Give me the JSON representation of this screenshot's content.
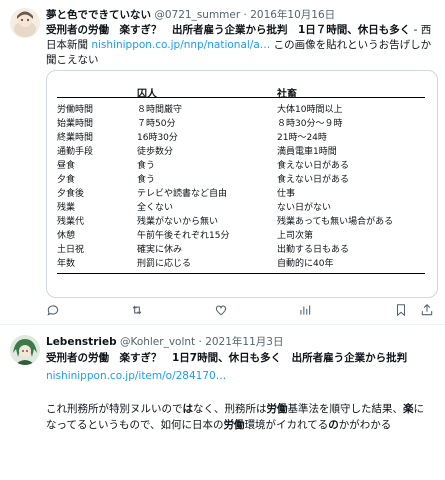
{
  "tweet1": {
    "name": "夢と色でできていない",
    "handle": "@0721_summer",
    "date": "· 2016年10月16日",
    "headline": "受刑者の労働　楽すぎ？　出所者雇う企業から批判　1日７時間、休日も多く",
    "source": " - 西日本新聞 ",
    "link": "nishinippon.co.jp/nnp/national/a…",
    "comment": " この画像を貼れというお告げしか聞こえない",
    "table": {
      "header": [
        "",
        "囚人",
        "社畜"
      ],
      "rows": [
        [
          "労働時間",
          "８時間厳守",
          "大体10時間以上"
        ],
        [
          "始業時間",
          "７時50分",
          "８時30分〜９時"
        ],
        [
          "終業時間",
          "16時30分",
          "21時〜24時"
        ],
        [
          "通勤手段",
          "徒歩数分",
          "満員電車1時間"
        ],
        [
          "昼食",
          "食う",
          "食えない日がある"
        ],
        [
          "夕食",
          "食う",
          "食えない日がある"
        ],
        [
          "夕食後",
          "テレビや読書など自由",
          "仕事"
        ],
        [
          "残業",
          "全くない",
          "ない日がない"
        ],
        [
          "残業代",
          "残業がないから無い",
          "残業あっても無い場合がある"
        ],
        [
          "休憩",
          "午前午後それぞれ15分",
          "上司次第"
        ],
        [
          "土日祝",
          "確実に休み",
          "出勤する日もある"
        ],
        [
          "年数",
          "刑罰に応じる",
          "自動的に40年"
        ]
      ]
    }
  },
  "tweet2": {
    "name": "Lebenstrieb",
    "handle": "@Kohler_volnt",
    "date": "· 2021年11月3日",
    "headline": "受刑者の労働　楽すぎ？　1日7時間、休日も多く　出所者雇う企業から批判",
    "link": "nishinippon.co.jp/item/o/284170…",
    "body_parts": [
      {
        "t": "これ刑務所が特別ヌルいので",
        "b": false
      },
      {
        "t": "は",
        "b": true
      },
      {
        "t": "なく、刑務所は",
        "b": false
      },
      {
        "t": "労働",
        "b": true
      },
      {
        "t": "基準法を順守した結果、",
        "b": false
      },
      {
        "t": "楽",
        "b": true
      },
      {
        "t": "になってるというもので、如何に日本の",
        "b": false
      },
      {
        "t": "労働",
        "b": true
      },
      {
        "t": "環境がイカれてる",
        "b": false
      },
      {
        "t": "の",
        "b": true
      },
      {
        "t": "かがわかる",
        "b": false
      }
    ]
  },
  "colors": {
    "link": "#1d9bf0",
    "meta": "#536471",
    "text": "#0f1419",
    "border": "#cfd9de"
  },
  "icons": [
    "reply-icon",
    "retweet-icon",
    "like-icon",
    "views-icon",
    "bookmark-icon",
    "share-icon"
  ]
}
